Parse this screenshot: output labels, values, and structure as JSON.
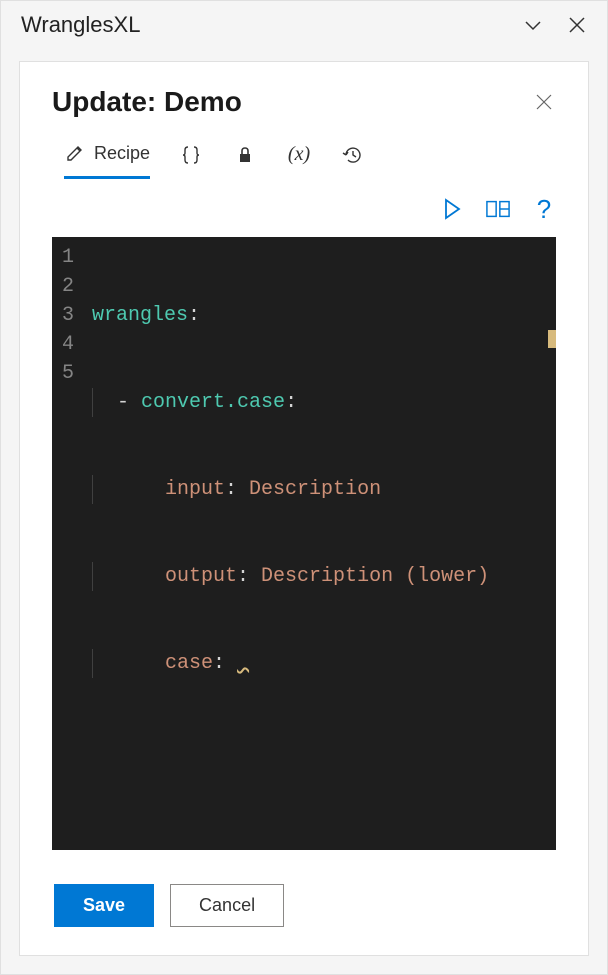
{
  "window": {
    "title": "WranglesXL"
  },
  "panel": {
    "title": "Update: Demo"
  },
  "tabs": {
    "recipe_label": "Recipe"
  },
  "editor": {
    "lines": {
      "l1_key": "wrangles",
      "l2_func": "convert.case",
      "l3_prop": "input",
      "l3_val": "Description",
      "l4_prop": "output",
      "l4_val": "Description (lower)",
      "l5_prop": "case"
    },
    "gutter": {
      "n1": "1",
      "n2": "2",
      "n3": "3",
      "n4": "4",
      "n5": "5"
    }
  },
  "footer": {
    "save_label": "Save",
    "cancel_label": "Cancel"
  }
}
